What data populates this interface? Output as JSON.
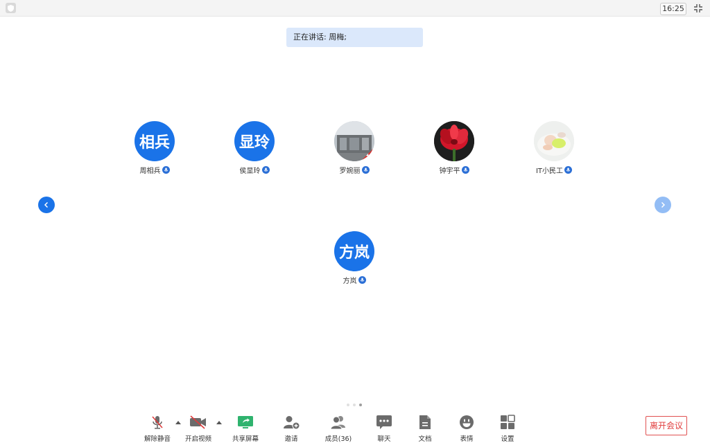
{
  "topbar": {
    "clock": "16:25"
  },
  "speaking": {
    "label": "正在讲话: 周梅;"
  },
  "participants": [
    {
      "name": "周相兵",
      "avatar_text": "相兵"
    },
    {
      "name": "侯显玲",
      "avatar_text": "显玲"
    },
    {
      "name": "罗婉丽",
      "avatar_text": ""
    },
    {
      "name": "钟宇平",
      "avatar_text": ""
    },
    {
      "name": "IT小民工",
      "avatar_text": ""
    },
    {
      "name": "方岚",
      "avatar_text": "方岚"
    }
  ],
  "pagination": {
    "pages": 3,
    "current": 3
  },
  "toolbar": {
    "unmute": "解除静音",
    "start_video": "开启视频",
    "share_screen": "共享屏幕",
    "invite": "邀请",
    "members": "成员(36)",
    "chat": "聊天",
    "docs": "文档",
    "emoji": "表情",
    "settings": "设置",
    "leave": "离开会议"
  },
  "colors": {
    "accent": "#1a73e8",
    "leave": "#e03b3b",
    "share": "#2fb36e"
  }
}
